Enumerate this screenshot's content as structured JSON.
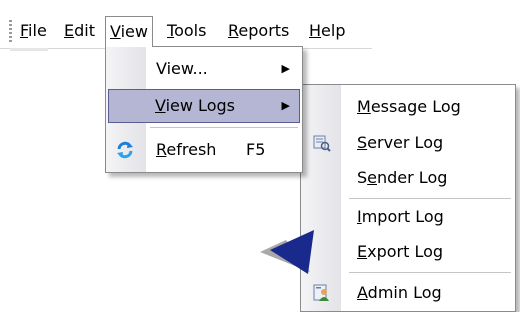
{
  "menubar": {
    "items": [
      {
        "label": "File",
        "mnemonic": "F",
        "rest": "ile"
      },
      {
        "label": "Edit",
        "mnemonic": "E",
        "rest": "dit"
      },
      {
        "label": "View",
        "mnemonic": "V",
        "rest": "iew"
      },
      {
        "label": "Tools",
        "mnemonic": "T",
        "rest": "ools"
      },
      {
        "label": "Reports",
        "mnemonic": "R",
        "rest": "eports"
      },
      {
        "label": "Help",
        "mnemonic": "H",
        "rest": "elp"
      }
    ]
  },
  "view_menu": {
    "items": [
      {
        "label": "View...",
        "has_submenu": true
      },
      {
        "label": "View Logs",
        "mnemonic": "V",
        "rest": "iew Logs",
        "has_submenu": true,
        "highlighted": true
      },
      {
        "label": "Refresh",
        "mnemonic": "R",
        "rest": "efresh",
        "shortcut": "F5",
        "icon": "refresh-icon"
      }
    ],
    "arrow_glyph": "▶"
  },
  "logs_menu": {
    "items": [
      {
        "label": "Message Log",
        "pre": "",
        "mnemonic": "M",
        "post": "essage Log"
      },
      {
        "label": "Server Log",
        "pre": "",
        "mnemonic": "S",
        "post": "erver Log",
        "icon": "server-log-icon"
      },
      {
        "label": "Sender Log",
        "pre": "S",
        "mnemonic": "e",
        "post": "nder Log"
      },
      {
        "label": "Import Log",
        "pre": "",
        "mnemonic": "I",
        "post": "mport Log"
      },
      {
        "label": "Export Log",
        "pre": "",
        "mnemonic": "E",
        "post": "xport Log"
      },
      {
        "label": "Admin Log",
        "pre": "",
        "mnemonic": "A",
        "post": "dmin Log",
        "icon": "admin-log-icon"
      }
    ]
  },
  "colors": {
    "highlight_bg": "#b4b6d4",
    "highlight_border": "#5c5c94",
    "pointer": "#1a2a8c"
  }
}
